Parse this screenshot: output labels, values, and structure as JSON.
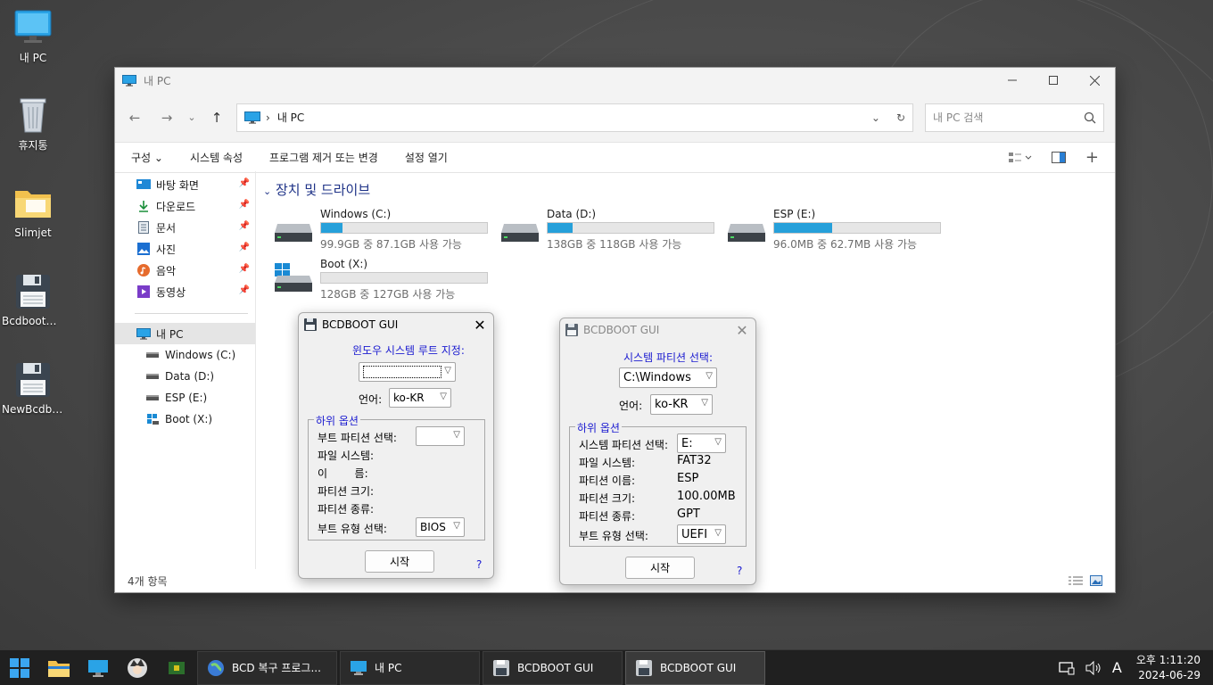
{
  "desktop": {
    "icons": [
      {
        "label": "내 PC"
      },
      {
        "label": "휴지통"
      },
      {
        "label": "Slimjet"
      },
      {
        "label": "BcdbootG..."
      },
      {
        "label": "NewBcdbo..."
      }
    ]
  },
  "explorer": {
    "title": "내 PC",
    "address": {
      "path": "내 PC",
      "separator": "›"
    },
    "search_placeholder": "내 PC 검색",
    "commands": [
      "구성",
      "시스템 속성",
      "프로그램 제거 또는 변경",
      "설정 열기"
    ],
    "organize_arrow": "⌄",
    "nav_quick": [
      {
        "label": "바탕 화면",
        "icon": "desktop-icon"
      },
      {
        "label": "다운로드",
        "icon": "download-icon"
      },
      {
        "label": "문서",
        "icon": "document-icon"
      },
      {
        "label": "사진",
        "icon": "pictures-icon"
      },
      {
        "label": "음악",
        "icon": "music-icon"
      },
      {
        "label": "동영상",
        "icon": "video-icon"
      }
    ],
    "nav_pc": {
      "label": "내 PC"
    },
    "nav_drives": [
      {
        "label": "Windows (C:)"
      },
      {
        "label": "Data (D:)"
      },
      {
        "label": "ESP (E:)"
      },
      {
        "label": "Boot (X:)"
      }
    ],
    "group_title": "장치 및 드라이브",
    "drives": [
      {
        "name": "Windows (C:)",
        "caption": "99.9GB 중 87.1GB 사용 가능",
        "used_fraction": 0.13
      },
      {
        "name": "Data (D:)",
        "caption": "138GB 중 118GB 사용 가능",
        "used_fraction": 0.15
      },
      {
        "name": "ESP (E:)",
        "caption": "96.0MB 중 62.7MB 사용 가능",
        "used_fraction": 0.35
      },
      {
        "name": "Boot (X:)",
        "caption": "128GB 중 127GB 사용 가능",
        "used_fraction": 0.0
      }
    ],
    "status": "4개 항목",
    "accent": "#26a0da"
  },
  "dialog1": {
    "title": "BCDBOOT GUI",
    "root_label": "윈도우 시스템 루트 지정:",
    "root_value": "",
    "lang_label": "언어:",
    "lang_value": "ko-KR",
    "sub_legend": "하위 옵션",
    "boot_part_label": "부트 파티션 선택:",
    "boot_part_value": "",
    "fs_label": "파일 시스템:",
    "name_label": "이        름:",
    "size_label": "파티션 크기:",
    "type_label": "파티션 종류:",
    "boot_type_label": "부트 유형 선택:",
    "boot_type_value": "BIOS",
    "start_label": "시작",
    "help": "?"
  },
  "dialog2": {
    "title": "BCDBOOT GUI",
    "sys_part_label": "시스템 파티션 선택:",
    "sys_part_value": "C:\\Windows",
    "lang_label": "언어:",
    "lang_value": "ko-KR",
    "sub_legend": "하위 옵션",
    "part_select_label": "시스템 파티션 선택:",
    "part_select_value": "E:",
    "fs_label": "파일 시스템:",
    "fs_value": "FAT32",
    "name_label": "파티션 이름:",
    "name_value": "ESP",
    "size_label": "파티션 크기:",
    "size_value": "100.00MB",
    "type_label": "파티션 종류:",
    "type_value": "GPT",
    "boot_type_label": "부트 유형 선택:",
    "boot_type_value": "UEFI",
    "start_label": "시작",
    "help": "?"
  },
  "taskbar": {
    "tasks": [
      {
        "label": "BCD 복구 프로그...",
        "active": false
      },
      {
        "label": "내 PC",
        "active": false
      },
      {
        "label": "BCDBOOT GUI",
        "active": false
      },
      {
        "label": "BCDBOOT GUI",
        "active": true
      }
    ],
    "ime": "A",
    "time": "오후 1:11:20",
    "date": "2024-06-29"
  }
}
